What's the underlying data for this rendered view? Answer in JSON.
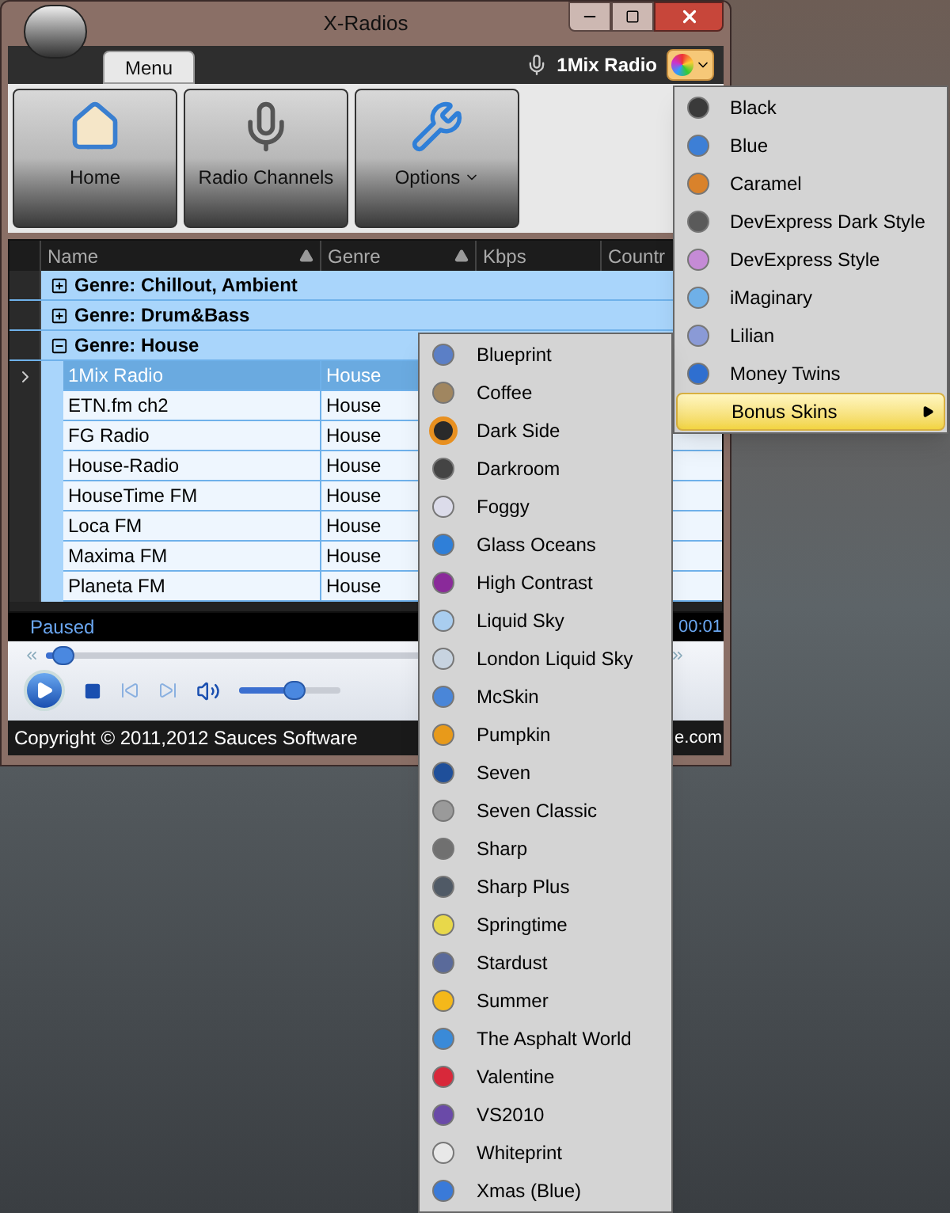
{
  "window": {
    "title": "X-Radios"
  },
  "ribbon": {
    "tabs": [
      {
        "label": "Menu",
        "selected": true
      }
    ],
    "now_playing": "1Mix Radio",
    "buttons": [
      {
        "label": "Home",
        "kind": "home",
        "dropdown": false
      },
      {
        "label": "Radio Channels",
        "kind": "mic",
        "dropdown": false
      },
      {
        "label": "Options",
        "kind": "tools",
        "dropdown": true
      }
    ]
  },
  "grid": {
    "columns": [
      "Name",
      "Genre",
      "Kbps",
      "Countr"
    ],
    "groups": [
      {
        "label": "Genre: Chillout, Ambient",
        "expanded": false
      },
      {
        "label": "Genre: Drum&Bass",
        "expanded": false
      },
      {
        "label": "Genre: House",
        "expanded": true,
        "children": [
          {
            "name": "1Mix Radio",
            "genre": "House",
            "selected": true
          },
          {
            "name": "ETN.fm ch2",
            "genre": "House",
            "selected": false
          },
          {
            "name": "FG Radio",
            "genre": "House",
            "selected": false
          },
          {
            "name": "House-Radio",
            "genre": "House",
            "selected": false
          },
          {
            "name": "HouseTime FM",
            "genre": "House",
            "selected": false
          },
          {
            "name": "Loca FM",
            "genre": "House",
            "selected": false
          },
          {
            "name": "Maxima FM",
            "genre": "House",
            "selected": false
          },
          {
            "name": "Planeta FM",
            "genre": "House",
            "selected": false
          }
        ]
      }
    ]
  },
  "status": {
    "state": "Paused",
    "time": "00:01"
  },
  "player": {
    "seek": {
      "level": 0.02
    },
    "volume": {
      "level": 0.5
    }
  },
  "footer": {
    "copyright": "Copyright ©  2011,2012 Sauces Software",
    "link": "e.com"
  },
  "skin_menu": [
    {
      "label": "Black",
      "color": "#3a3a3a",
      "selected": false,
      "submenu": false
    },
    {
      "label": "Blue",
      "color": "#3d7fd6",
      "selected": false,
      "submenu": false
    },
    {
      "label": "Caramel",
      "color": "#d9822b",
      "selected": false,
      "submenu": false
    },
    {
      "label": "DevExpress Dark Style",
      "color": "#5a5a5a",
      "selected": false,
      "submenu": false
    },
    {
      "label": "DevExpress Style",
      "color": "#c58bd6",
      "selected": false,
      "submenu": false
    },
    {
      "label": "iMaginary",
      "color": "#6fb0e8",
      "selected": false,
      "submenu": false
    },
    {
      "label": "Lilian",
      "color": "#8a9ad6",
      "selected": false,
      "submenu": false
    },
    {
      "label": "Money Twins",
      "color": "#2f6fd0",
      "selected": false,
      "submenu": false
    },
    {
      "label": "Bonus Skins",
      "selected": true,
      "submenu": true
    }
  ],
  "bonus_skins": [
    {
      "label": "Blueprint",
      "color": "#5b7fc6",
      "selected": false
    },
    {
      "label": "Coffee",
      "color": "#a08660",
      "selected": false
    },
    {
      "label": "Dark Side",
      "color": "#2a2a2a",
      "selected": true
    },
    {
      "label": "Darkroom",
      "color": "#444444",
      "selected": false
    },
    {
      "label": "Foggy",
      "color": "#dcdcea",
      "selected": false
    },
    {
      "label": "Glass Oceans",
      "color": "#2f7fd8",
      "selected": false
    },
    {
      "label": "High Contrast",
      "color": "#8a2a9a",
      "selected": false
    },
    {
      "label": "Liquid Sky",
      "color": "#a9cdef",
      "selected": false
    },
    {
      "label": "London Liquid Sky",
      "color": "#c7d3e0",
      "selected": false
    },
    {
      "label": "McSkin",
      "color": "#4a86d8",
      "selected": false
    },
    {
      "label": "Pumpkin",
      "color": "#e89a1a",
      "selected": false
    },
    {
      "label": "Seven",
      "color": "#1f4f9a",
      "selected": false
    },
    {
      "label": "Seven Classic",
      "color": "#9a9a9a",
      "selected": false
    },
    {
      "label": "Sharp",
      "color": "#707070",
      "selected": false
    },
    {
      "label": "Sharp Plus",
      "color": "#505a66",
      "selected": false
    },
    {
      "label": "Springtime",
      "color": "#e8d84a",
      "selected": false
    },
    {
      "label": "Stardust",
      "color": "#5a6a9a",
      "selected": false
    },
    {
      "label": "Summer",
      "color": "#f4b81a",
      "selected": false
    },
    {
      "label": "The Asphalt World",
      "color": "#3a8ad8",
      "selected": false
    },
    {
      "label": "Valentine",
      "color": "#d8283a",
      "selected": false
    },
    {
      "label": "VS2010",
      "color": "#6a4aa8",
      "selected": false
    },
    {
      "label": "Whiteprint",
      "color": "#e8e8e8",
      "selected": false
    },
    {
      "label": "Xmas (Blue)",
      "color": "#3a7ad8",
      "selected": false
    }
  ]
}
